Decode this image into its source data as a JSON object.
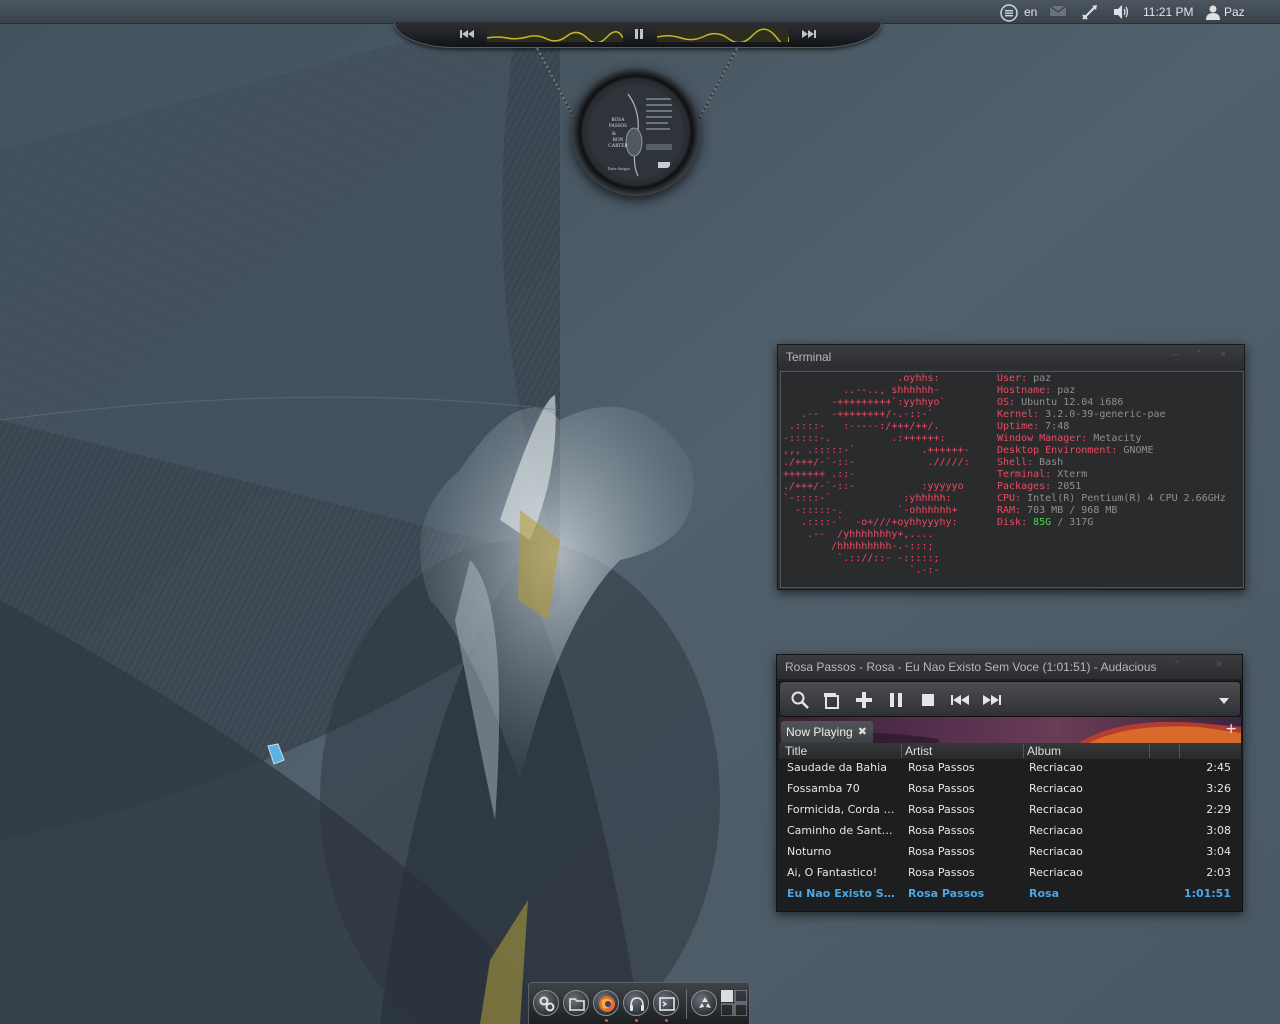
{
  "top_panel": {
    "keyboard_layout": "en",
    "clock": "11:21 PM",
    "user": "Paz",
    "icons": [
      "appmenu-icon",
      "mail-icon",
      "network-icon",
      "volume-icon",
      "user-icon"
    ]
  },
  "music_bar": {
    "icons": [
      "previous-icon",
      "pause-icon",
      "next-icon"
    ]
  },
  "album_art": {
    "artist_text": "ROSA PASSOS",
    "connector_text": "&",
    "partner_text": "RON CARTER",
    "subtitle_text": "Entre Amigos"
  },
  "terminal": {
    "title": "Terminal",
    "logo_lines": [
      "                   .oyhhs:",
      "          ..--.., shhhhhh-",
      "        -+++++++++`:yyhhyo`",
      "   .--  -++++++++/-.-::-`",
      " .::::-   :-----:/+++/++/.",
      "-:::::-.          .:++++++:",
      ",,, .:::::-`           .++++++-",
      "./+++/-`-::-            ./////:",
      "+++++++ .::-",
      "./+++/-`-::-           :yyyyyo",
      "`-::::-`            :yhhhhh:",
      "  -:::::-.         `-ohhhhhh+",
      "   .::::-`  -o+///+oyhhyyyhy:",
      "    .--  /yhhhhhhhy+,....",
      "        /hhhhhhhhh-.-:::;",
      "         `.:://::- -:::::;",
      "                     `.-:-"
    ],
    "info": [
      {
        "key": "User:",
        "value": "paz"
      },
      {
        "key": "Hostname:",
        "value": "paz"
      },
      {
        "key": "OS:",
        "value": "Ubuntu 12.04 i686"
      },
      {
        "key": "Kernel:",
        "value": "3.2.0-39-generic-pae"
      },
      {
        "key": "Uptime:",
        "value": "7:48"
      },
      {
        "key": "Window Manager:",
        "value": "Metacity"
      },
      {
        "key": "Desktop Environment:",
        "value": "GNOME"
      },
      {
        "key": "Shell:",
        "value": "Bash"
      },
      {
        "key": "Terminal:",
        "value": "Xterm"
      },
      {
        "key": "Packages:",
        "value": "2051"
      },
      {
        "key": "CPU:",
        "value": "Intel(R) Pentium(R) 4 CPU 2.66GHz"
      },
      {
        "key": "RAM:",
        "value": "703 MB",
        "value2": " / 968 MB"
      },
      {
        "key": "Disk:",
        "value": "85G",
        "value2": " / 317G"
      }
    ]
  },
  "audacious": {
    "title": "Rosa Passos - Rosa - Eu Nao Existo Sem Voce (1:01:51) - Audacious",
    "tab_label": "Now Playing",
    "toolbar_icons": [
      "search-icon",
      "open-icon",
      "add-icon",
      "pause-icon",
      "stop-icon",
      "previous-icon",
      "next-icon",
      "menu-dropdown-icon"
    ],
    "columns": [
      "Title",
      "Artist",
      "Album"
    ],
    "rows": [
      {
        "title": "Saudade da Bahia",
        "artist": "Rosa Passos",
        "album": "Recriacao",
        "length": "2:45"
      },
      {
        "title": "Fossamba 70",
        "artist": "Rosa Passos",
        "album": "Recriacao",
        "length": "3:26"
      },
      {
        "title": "Formicida, Corda e ...",
        "artist": "Rosa Passos",
        "album": "Recriacao",
        "length": "2:29"
      },
      {
        "title": "Caminho de Santana",
        "artist": "Rosa Passos",
        "album": "Recriacao",
        "length": "3:08"
      },
      {
        "title": "Noturno",
        "artist": "Rosa Passos",
        "album": "Recriacao",
        "length": "3:04"
      },
      {
        "title": "Ai, O Fantastico!",
        "artist": "Rosa Passos",
        "album": "Recriacao",
        "length": "2:03"
      },
      {
        "title": "Eu Nao Existo Sem ...",
        "artist": "Rosa Passos",
        "album": "Rosa",
        "length": "1:01:51",
        "playing": true
      }
    ]
  },
  "dock": {
    "icons": [
      "system-settings-icon",
      "file-manager-icon",
      "firefox-icon",
      "music-player-icon",
      "terminal-icon",
      "trash-icon",
      "workspace-switcher-icon"
    ]
  }
}
